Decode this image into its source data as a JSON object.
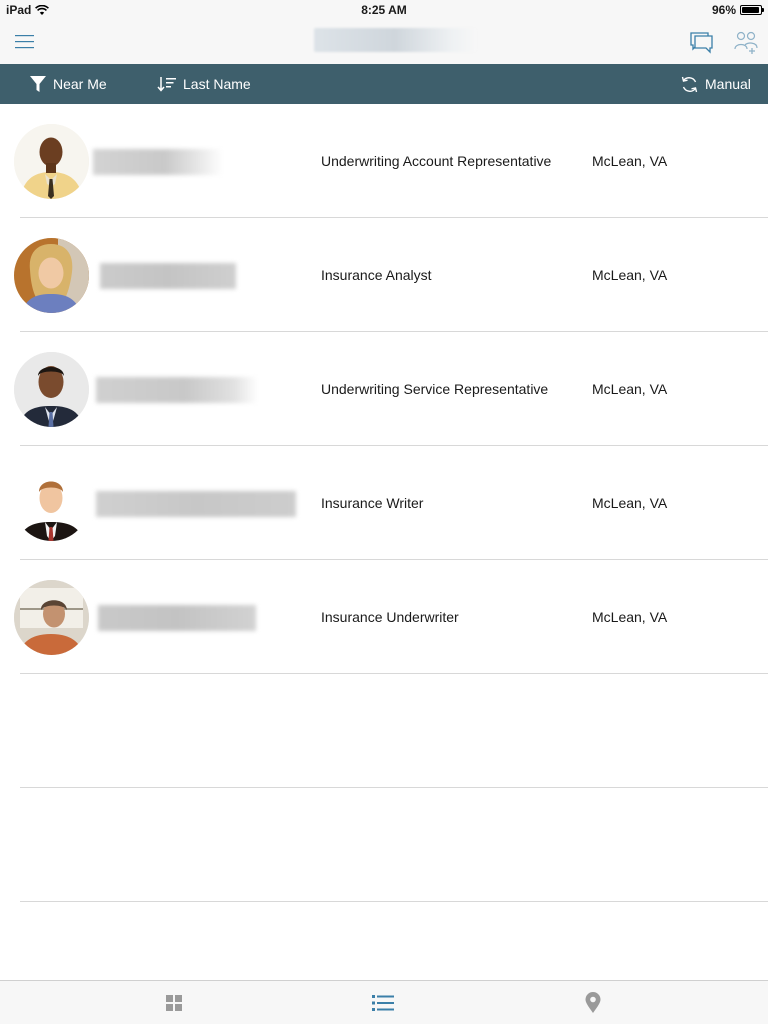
{
  "status": {
    "device": "iPad",
    "time": "8:25 AM",
    "battery": "96%",
    "battery_level": 0.96
  },
  "nav": {
    "menu_icon": "hamburger-menu-icon",
    "chat_icon": "chat-bubbles-icon",
    "group_icon": "add-group-icon"
  },
  "filters": {
    "near_me": "Near Me",
    "sort": "Last Name",
    "refresh": "Manual"
  },
  "colors": {
    "filter_bar": "#3e5f6c",
    "accent": "#3b7fa8",
    "tab_inactive": "#9a9a9a"
  },
  "people": [
    {
      "role": "Underwriting Account Representative",
      "location": "McLean, VA"
    },
    {
      "role": "Insurance Analyst",
      "location": "McLean, VA"
    },
    {
      "role": "Underwriting Service Representative",
      "location": "McLean, VA"
    },
    {
      "role": "Insurance Writer",
      "location": "McLean, VA"
    },
    {
      "role": "Insurance Underwriter",
      "location": "McLean, VA"
    }
  ],
  "tabs": [
    {
      "icon": "grid-icon",
      "active": false
    },
    {
      "icon": "list-icon",
      "active": true
    },
    {
      "icon": "map-pin-icon",
      "active": false
    }
  ]
}
